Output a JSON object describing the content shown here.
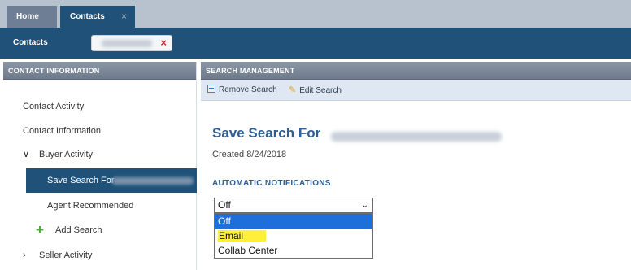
{
  "tabs": [
    {
      "label": "Home"
    },
    {
      "label": "Contacts",
      "close": "×"
    }
  ],
  "context_bar": {
    "label": "Contacts",
    "chip_close": "×"
  },
  "left_panel": {
    "header": "CONTACT INFORMATION",
    "items": [
      {
        "label": "Contact Activity"
      },
      {
        "label": "Contact Information"
      },
      {
        "label": "Buyer Activity",
        "chevron": "∨"
      },
      {
        "label": "Save Search For"
      },
      {
        "label": "Agent Recommended"
      },
      {
        "label": "Add Search",
        "icon": "+"
      },
      {
        "label": "Seller Activity",
        "chevron": "›"
      }
    ]
  },
  "right_panel": {
    "header": "SEARCH MANAGEMENT",
    "toolbar": {
      "remove_label": "Remove Search",
      "edit_label": "Edit Search"
    },
    "title": "Save Search For",
    "created": "Created 8/24/2018",
    "notifications_label": "AUTOMATIC NOTIFICATIONS",
    "select": {
      "value": "Off",
      "chevron": "⌄",
      "options": [
        "Off",
        "Email",
        "Collab Center"
      ]
    }
  },
  "colors": {
    "nav_blue": "#1f5179",
    "title_blue": "#2e6095",
    "selected_option": "#1e6fd9",
    "highlight": "#ffef3a",
    "add_icon": "#3fae2a",
    "chip_close": "#d0202a"
  }
}
